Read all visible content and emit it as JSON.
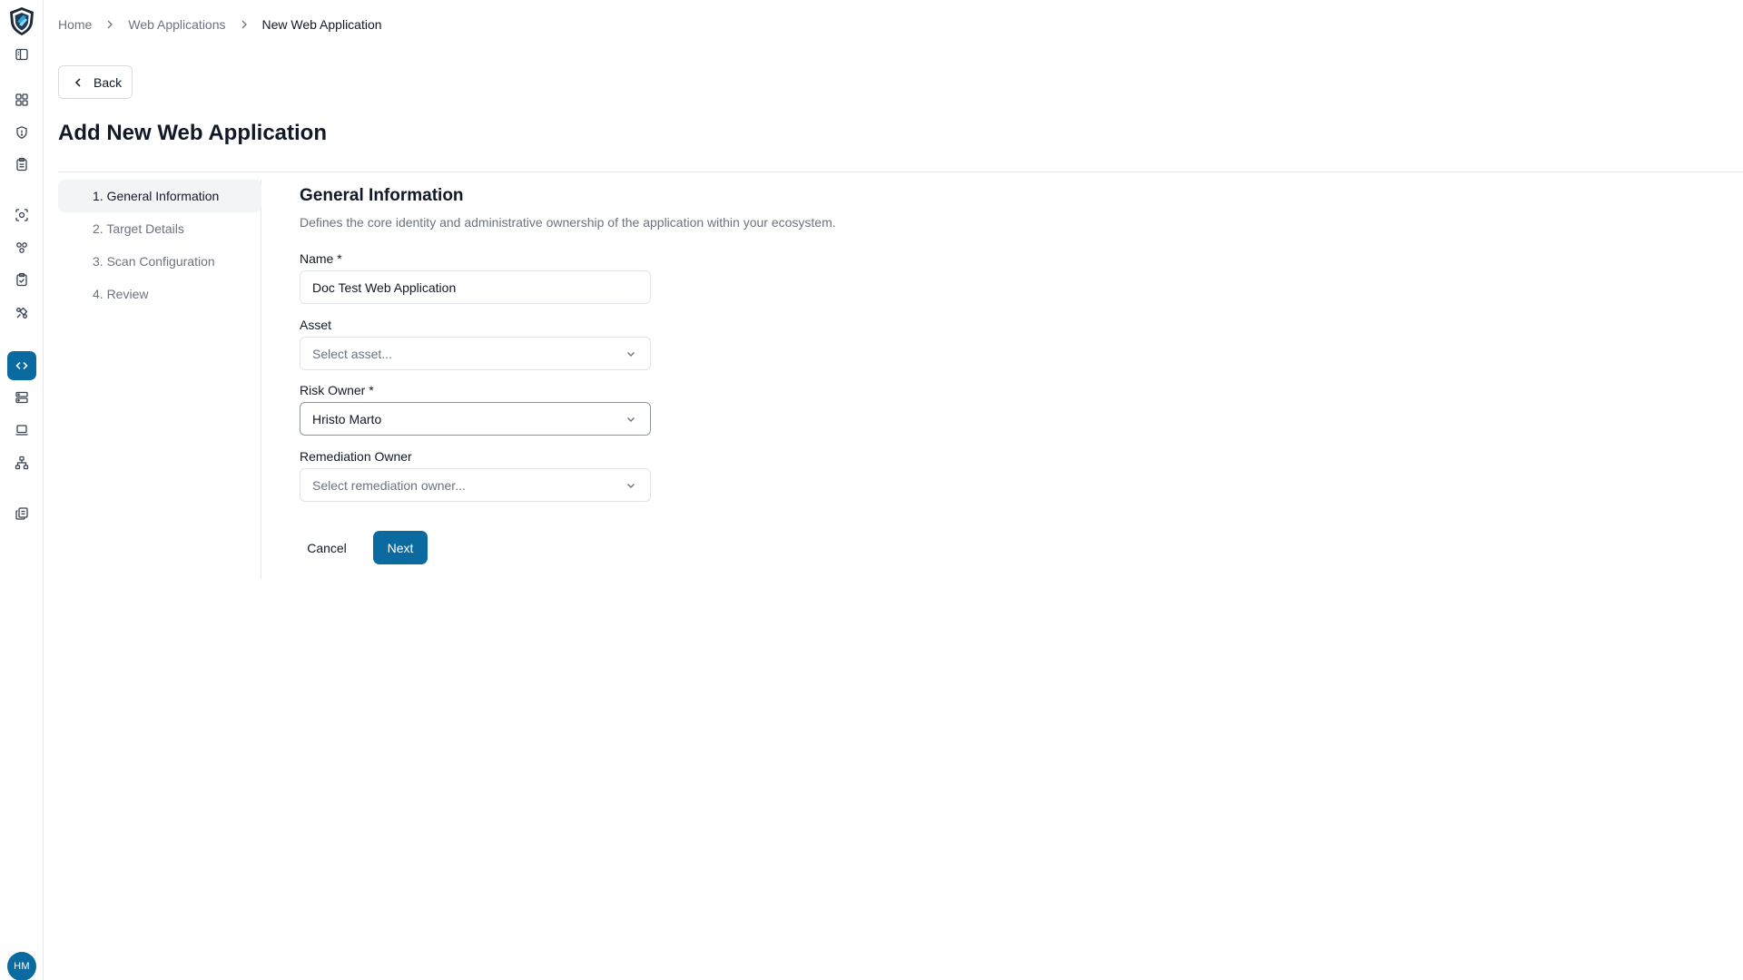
{
  "app": {
    "accent_color": "#0b6a9f",
    "user_initials": "HM"
  },
  "sidebar": {
    "icons": [
      {
        "name": "sidebar-toggle-icon"
      },
      {
        "name": "dashboard-icon"
      },
      {
        "name": "shield-icon"
      },
      {
        "name": "clipboard-list-icon"
      },
      {
        "name": "scan-target-icon"
      },
      {
        "name": "group-icon"
      },
      {
        "name": "clipboard-check-icon"
      },
      {
        "name": "integrations-icon"
      },
      {
        "name": "code-icon",
        "active": true
      },
      {
        "name": "server-icon"
      },
      {
        "name": "laptop-icon"
      },
      {
        "name": "network-icon"
      },
      {
        "name": "documents-icon"
      }
    ]
  },
  "breadcrumb": {
    "home": "Home",
    "parent": "Web Applications",
    "current": "New Web Application"
  },
  "back_button": "Back",
  "page_title": "Add New Web Application",
  "steps": [
    {
      "label": "1. General Information",
      "active": true
    },
    {
      "label": "2. Target Details",
      "active": false
    },
    {
      "label": "3. Scan Configuration",
      "active": false
    },
    {
      "label": "4. Review",
      "active": false
    }
  ],
  "form": {
    "section_title": "General Information",
    "section_description": "Defines the core identity and administrative ownership of the application within your ecosystem.",
    "name": {
      "label": "Name *",
      "value": "Doc Test Web Application"
    },
    "asset": {
      "label": "Asset",
      "placeholder": "Select asset..."
    },
    "risk_owner": {
      "label": "Risk Owner *",
      "value": "Hristo Marto"
    },
    "remediation_owner": {
      "label": "Remediation Owner",
      "placeholder": "Select remediation owner..."
    }
  },
  "actions": {
    "cancel": "Cancel",
    "next": "Next"
  }
}
